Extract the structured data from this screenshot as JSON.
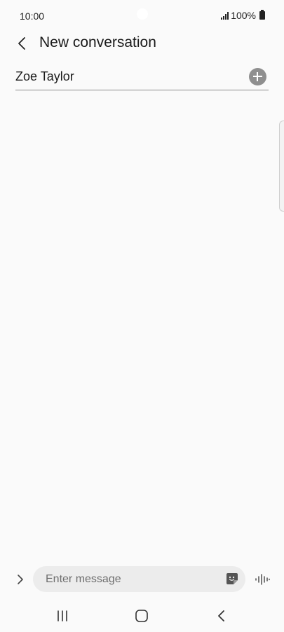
{
  "status_bar": {
    "time": "10:00",
    "battery": "100%"
  },
  "header": {
    "title": "New conversation",
    "back_icon": "chevron-left-icon"
  },
  "recipient": {
    "name": "Zoe Taylor",
    "add_icon": "plus-circle-icon"
  },
  "composer": {
    "placeholder": "Enter message",
    "expand_icon": "chevron-right-icon",
    "sticker_icon": "sticker-icon",
    "voice_icon": "voice-waveform-icon"
  },
  "nav_bar": {
    "recents_icon": "recents-icon",
    "home_icon": "home-icon",
    "back_icon": "back-icon"
  },
  "colors": {
    "background": "#fafafa",
    "field": "#ececec",
    "add_button": "#8f8f8f"
  }
}
